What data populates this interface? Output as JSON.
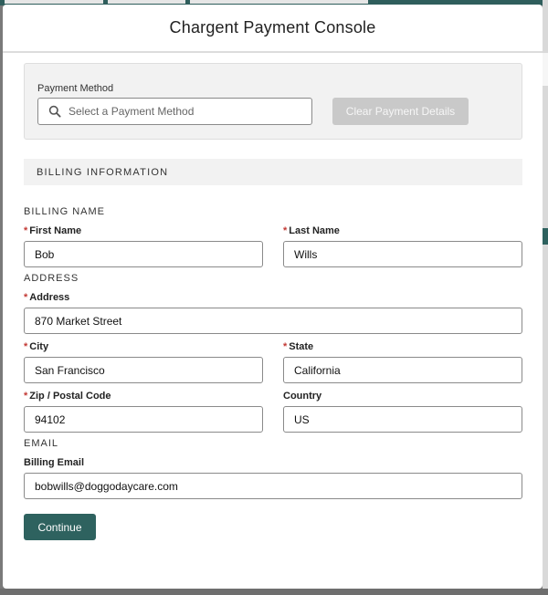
{
  "modal": {
    "title": "Chargent Payment Console"
  },
  "payment": {
    "label": "Payment Method",
    "placeholder": "Select a Payment Method",
    "clear_button": "Clear Payment Details"
  },
  "billing": {
    "section_title": "BILLING INFORMATION",
    "name_group": "BILLING NAME",
    "address_group": "ADDRESS",
    "email_group": "EMAIL",
    "required_marker": "*",
    "fields": {
      "first_name": {
        "label": "First Name",
        "value": "Bob",
        "required": true
      },
      "last_name": {
        "label": "Last Name",
        "value": "Wills",
        "required": true
      },
      "address": {
        "label": "Address",
        "value": "870 Market Street",
        "required": true
      },
      "city": {
        "label": "City",
        "value": "San Francisco",
        "required": true
      },
      "state": {
        "label": "State",
        "value": "California",
        "required": true
      },
      "zip": {
        "label": "Zip / Postal Code",
        "value": "94102",
        "required": true
      },
      "country": {
        "label": "Country",
        "value": "US",
        "required": false
      },
      "email": {
        "label": "Billing Email",
        "value": "bobwills@doggodaycare.com",
        "required": false
      }
    }
  },
  "actions": {
    "continue": "Continue"
  },
  "colors": {
    "brand": "#2e625f",
    "required": "#c23934",
    "disabled_button": "#c9c9c9",
    "panel_bg": "#f2f2f2"
  },
  "icons": {
    "payment_search": "search-icon"
  }
}
